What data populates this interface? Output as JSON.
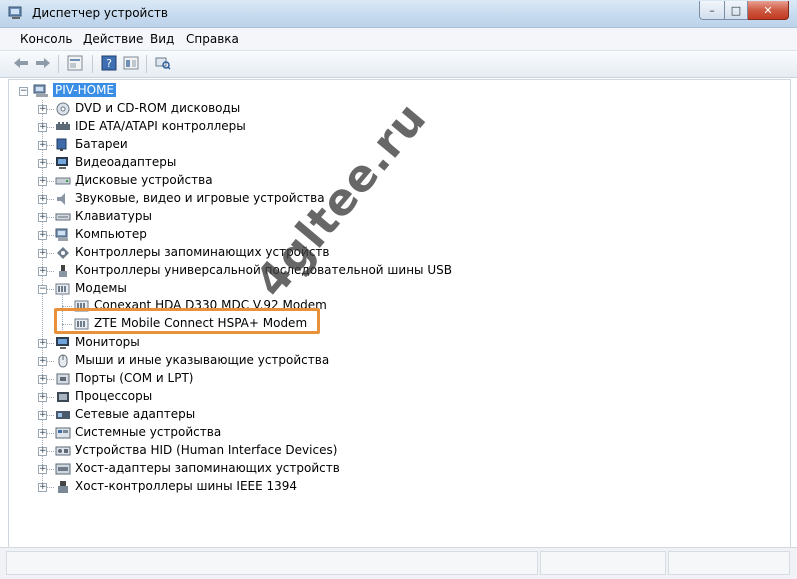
{
  "window": {
    "title": "Диспетчер устройств",
    "controls": {
      "minimize": "–",
      "maximize": "□",
      "close": "✕"
    }
  },
  "menu": [
    {
      "label": "Консоль"
    },
    {
      "label": "Действие"
    },
    {
      "label": "Вид"
    },
    {
      "label": "Справка"
    }
  ],
  "toolbar": {
    "buttons": [
      "back-arrow-icon",
      "forward-arrow-icon",
      "properties-icon",
      "help-icon",
      "view-icon",
      "scan-hardware-icon"
    ]
  },
  "tree": {
    "root": "PIV-HOME",
    "categories": [
      {
        "label": "DVD и CD-ROM дисководы",
        "icon": "cdrom-icon"
      },
      {
        "label": "IDE ATA/ATAPI контроллеры",
        "icon": "ide-controller-icon"
      },
      {
        "label": "Батареи",
        "icon": "battery-icon"
      },
      {
        "label": "Видеоадаптеры",
        "icon": "display-adapter-icon"
      },
      {
        "label": "Дисковые устройства",
        "icon": "disk-drive-icon"
      },
      {
        "label": "Звуковые, видео и игровые устройства",
        "icon": "sound-icon"
      },
      {
        "label": "Клавиатуры",
        "icon": "keyboard-icon"
      },
      {
        "label": "Компьютер",
        "icon": "computer-icon"
      },
      {
        "label": "Контроллеры запоминающих устройств",
        "icon": "storage-controller-icon"
      },
      {
        "label": "Контроллеры универсальной последовательной шины USB",
        "icon": "usb-icon"
      },
      {
        "label": "Модемы",
        "icon": "modem-icon",
        "expanded": true,
        "children": [
          {
            "label": "Conexant HDA D330 MDC V.92 Modem"
          },
          {
            "label": "ZTE Mobile Connect HSPA+ Modem"
          }
        ]
      },
      {
        "label": "Мониторы",
        "icon": "monitor-icon"
      },
      {
        "label": "Мыши и иные указывающие устройства",
        "icon": "mouse-icon"
      },
      {
        "label": "Порты (COM и LPT)",
        "icon": "port-icon"
      },
      {
        "label": "Процессоры",
        "icon": "processor-icon"
      },
      {
        "label": "Сетевые адаптеры",
        "icon": "network-adapter-icon"
      },
      {
        "label": "Системные устройства",
        "icon": "system-device-icon"
      },
      {
        "label": "Устройства HID (Human Interface Devices)",
        "icon": "hid-icon"
      },
      {
        "label": "Хост-адаптеры запоминающих устройств",
        "icon": "storage-host-icon"
      },
      {
        "label": "Хост-контроллеры шины IEEE 1394",
        "icon": "ieee1394-icon"
      }
    ]
  },
  "watermark": "4gltee.ru",
  "colors": {
    "highlight": "#e8903a",
    "selection": "#3a8ee6"
  }
}
